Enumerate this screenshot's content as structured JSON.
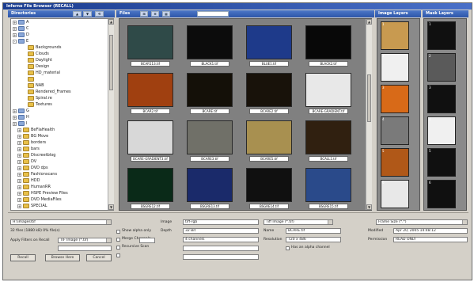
{
  "window": {
    "title": "Inferno File Browser (RECALL)"
  },
  "panels": {
    "directories": "Directories",
    "files": "Files",
    "image_layers": "Image Layers",
    "mask_layers": "Mask Layers"
  },
  "tree": {
    "nodes": [
      {
        "label": "A",
        "indent": 0,
        "expander": "+",
        "icon": "drive"
      },
      {
        "label": "C",
        "indent": 0,
        "expander": "+",
        "icon": "drive"
      },
      {
        "label": "D",
        "indent": 0,
        "expander": "+",
        "icon": "drive"
      },
      {
        "label": "E",
        "indent": 0,
        "expander": "-",
        "icon": "drive"
      },
      {
        "label": "Backgrounds",
        "indent": 2,
        "expander": "",
        "icon": "folder"
      },
      {
        "label": "Clouds",
        "indent": 2,
        "expander": "",
        "icon": "folder"
      },
      {
        "label": "Daylight",
        "indent": 2,
        "expander": "",
        "icon": "folder"
      },
      {
        "label": "Design",
        "indent": 2,
        "expander": "",
        "icon": "folder"
      },
      {
        "label": "HD_material",
        "indent": 2,
        "expander": "",
        "icon": "folder"
      },
      {
        "label": "",
        "indent": 2,
        "expander": "",
        "icon": "folder",
        "selected": true
      },
      {
        "label": "NAB",
        "indent": 2,
        "expander": "",
        "icon": "folder"
      },
      {
        "label": "Rendered_Frames",
        "indent": 2,
        "expander": "",
        "icon": "folder"
      },
      {
        "label": "Spiral.re",
        "indent": 2,
        "expander": "",
        "icon": "folder"
      },
      {
        "label": "Textures",
        "indent": 2,
        "expander": "",
        "icon": "folder"
      },
      {
        "label": "G",
        "indent": 0,
        "expander": "+",
        "icon": "drive"
      },
      {
        "label": "H",
        "indent": 0,
        "expander": "+",
        "icon": "drive"
      },
      {
        "label": "I",
        "indent": 0,
        "expander": "+",
        "icon": "drive"
      },
      {
        "label": "BeFlaHealth",
        "indent": 1,
        "expander": "+",
        "icon": "folder"
      },
      {
        "label": "BG Move",
        "indent": 1,
        "expander": "+",
        "icon": "folder"
      },
      {
        "label": "borders",
        "indent": 1,
        "expander": "+",
        "icon": "folder"
      },
      {
        "label": "bars",
        "indent": 1,
        "expander": "+",
        "icon": "folder"
      },
      {
        "label": "Discreetblog",
        "indent": 1,
        "expander": "+",
        "icon": "folder"
      },
      {
        "label": "DV",
        "indent": 1,
        "expander": "+",
        "icon": "folder"
      },
      {
        "label": "DVD dps",
        "indent": 1,
        "expander": "+",
        "icon": "folder"
      },
      {
        "label": "Fashionscans",
        "indent": 1,
        "expander": "+",
        "icon": "folder"
      },
      {
        "label": "HDD",
        "indent": 1,
        "expander": "+",
        "icon": "folder"
      },
      {
        "label": "HumanRR",
        "indent": 1,
        "expander": "+",
        "icon": "folder"
      },
      {
        "label": "HSPE Preview Files",
        "indent": 1,
        "expander": "+",
        "icon": "folder"
      },
      {
        "label": "DVD MediaFiles",
        "indent": 1,
        "expander": "+",
        "icon": "folder"
      },
      {
        "label": "SPECIAL",
        "indent": 1,
        "expander": "+",
        "icon": "folder"
      }
    ]
  },
  "toolbar": {
    "btn1": "▲",
    "btn2": "▼",
    "btn3": "⟲",
    "view1": "⊞",
    "view2": "≡",
    "view3": "▦"
  },
  "thumbnails": [
    {
      "caption": "BCAR113.tif",
      "bg": "#2f4a48"
    },
    {
      "caption": "BLACK1.tif",
      "bg": "#0c0c0c"
    },
    {
      "caption": "BLUE1.tif",
      "bg": "#1e3a8a"
    },
    {
      "caption": "BLACK2.tif",
      "bg": "#080808"
    },
    {
      "caption": "BCAR2.tif",
      "bg": "#a04010"
    },
    {
      "caption": "BCARE.tif",
      "bg": "#141008"
    },
    {
      "caption": "BCARE2.tif",
      "bg": "#18120a"
    },
    {
      "caption": "BCARE-GRADIENT.tif",
      "bg": "#e8e8e8"
    },
    {
      "caption": "BCARE-GRADIENT3.tif",
      "bg": "#d8d8d8"
    },
    {
      "caption": "BCARE3.tif",
      "bg": "#707068"
    },
    {
      "caption": "BCARE5.tif",
      "bg": "#a89050"
    },
    {
      "caption": "BCALL1.tif",
      "bg": "#302010"
    },
    {
      "caption": "BSGRE12.tif",
      "bg": "#0a2a18"
    },
    {
      "caption": "BSGRE13.tif",
      "bg": "#1a2a6a"
    },
    {
      "caption": "BSGRE14.tif",
      "bg": "#101010"
    },
    {
      "caption": "BSGRE15.tif",
      "bg": "#2a4a8a"
    }
  ],
  "image_layers": [
    {
      "num": "1",
      "bg": "#c89a50"
    },
    {
      "num": "2",
      "bg": "#f0f0f0"
    },
    {
      "num": "3",
      "bg": "#d86a18"
    },
    {
      "num": "4",
      "bg": "#7a7a7a"
    },
    {
      "num": "5",
      "bg": "#b05818"
    },
    {
      "num": "6",
      "bg": "#e8e8e8"
    }
  ],
  "mask_layers": [
    {
      "num": "1",
      "bg": "#101010"
    },
    {
      "num": "2",
      "bg": "#5a5a5a"
    },
    {
      "num": "3",
      "bg": "#101010"
    },
    {
      "num": "4",
      "bg": "#f0f0f0"
    },
    {
      "num": "5",
      "bg": "#101010"
    },
    {
      "num": "6",
      "bg": "#101010"
    }
  ],
  "bottom": {
    "path": "H:\\images\\tif",
    "info": "32 files (1880 kB) 0% file(s)",
    "apply_filters_label": "Apply Filters on Recall",
    "apply_filters_value": "TIF Image (*.tif)",
    "recall_btn": "Recall",
    "browse_btn": "Browse Here",
    "cancel_btn": "Cancel",
    "opt1": "Show alpha only",
    "opt2": "Merge Channels",
    "opt3": "Recursive Scan",
    "format_label": "Format",
    "format_value": "Tiff Image (*.tif)",
    "size_label": "Size",
    "field_a_label": "Image",
    "field_a_value": "tiff-rgb",
    "field_b_label": "Depth",
    "field_b_value": "32 Bit",
    "field_c_value": "4 channels",
    "name_label": "Name",
    "name_value": "BCARE.tif",
    "res_label": "Resolution",
    "res_value": "720 x 486",
    "alpha_label": "Has an alpha channel",
    "layer_combo": "Frame Size (*.*)",
    "modified_label": "Modified",
    "modified_value": "Apr 20, 2005 14:48:12",
    "permission_label": "Permission",
    "permission_value": "READ ONLY"
  }
}
